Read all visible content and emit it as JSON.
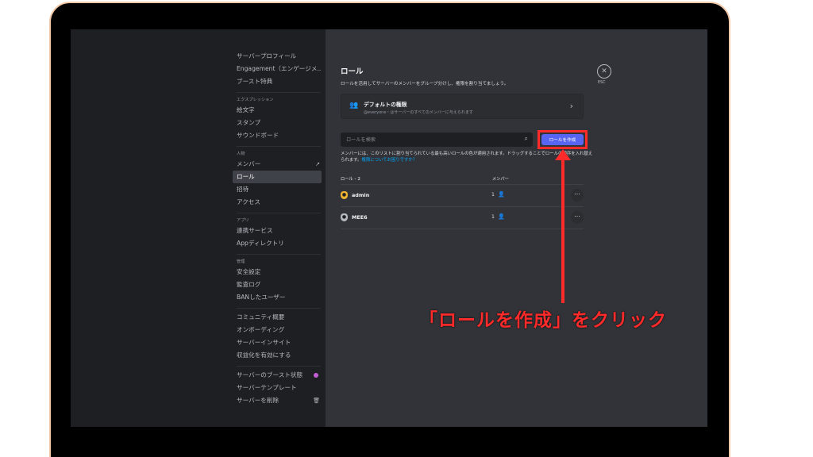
{
  "sidebar": {
    "items": [
      {
        "label": "サーバープロフィール"
      },
      {
        "label": "Engagement（エンゲージメ..."
      },
      {
        "label": "ブースト特典"
      }
    ],
    "cat_expression": "エクスプレッション",
    "expression": [
      {
        "label": "絵文字"
      },
      {
        "label": "スタンプ"
      },
      {
        "label": "サウンドボード"
      }
    ],
    "cat_people": "人物",
    "people": [
      {
        "label": "メンバー"
      },
      {
        "label": "ロール"
      },
      {
        "label": "招待"
      },
      {
        "label": "アクセス"
      }
    ],
    "cat_apps": "アプリ",
    "apps": [
      {
        "label": "連携サービス"
      },
      {
        "label": "Appディレクトリ"
      }
    ],
    "cat_moderation": "管理",
    "moderation": [
      {
        "label": "安全設定"
      },
      {
        "label": "監査ログ"
      },
      {
        "label": "BANしたユーザー"
      }
    ],
    "community": [
      {
        "label": "コミュニティ概要"
      },
      {
        "label": "オンボーディング"
      },
      {
        "label": "サーバーインサイト"
      },
      {
        "label": "収益化を有効にする"
      }
    ],
    "bottom": [
      {
        "label": "サーバーのブースト状態"
      },
      {
        "label": "サーバーテンプレート"
      },
      {
        "label": "サーバーを削除"
      }
    ]
  },
  "main": {
    "title": "ロール",
    "description": "ロールを活用してサーバーのメンバーをグループ分けし、権限を割り当てましょう。",
    "default_perm": {
      "title": "デフォルトの権限",
      "subtitle": "@everyone・はサーバーのすべてのメンバーに与えられます"
    },
    "search_placeholder": "ロールを検索",
    "create_button": "ロールを作成",
    "note": "メンバーには、このリストに割り当てられている最も高いロールの色が適用されます。ドラッグすることでロールの順序を入れ替えられます。",
    "note_link": "権限についてお困りですか？",
    "table_headers": {
      "roles": "ロール - 2",
      "members": "メンバー"
    },
    "roles": [
      {
        "name": "admin",
        "members": "1",
        "color": "#f0b232"
      },
      {
        "name": "MEE6",
        "members": "1",
        "color": "#b5bac1"
      }
    ],
    "esc_label": "ESC"
  },
  "annotation": {
    "text": "「ロールを作成」をクリック",
    "color": "#ff2a2a"
  }
}
